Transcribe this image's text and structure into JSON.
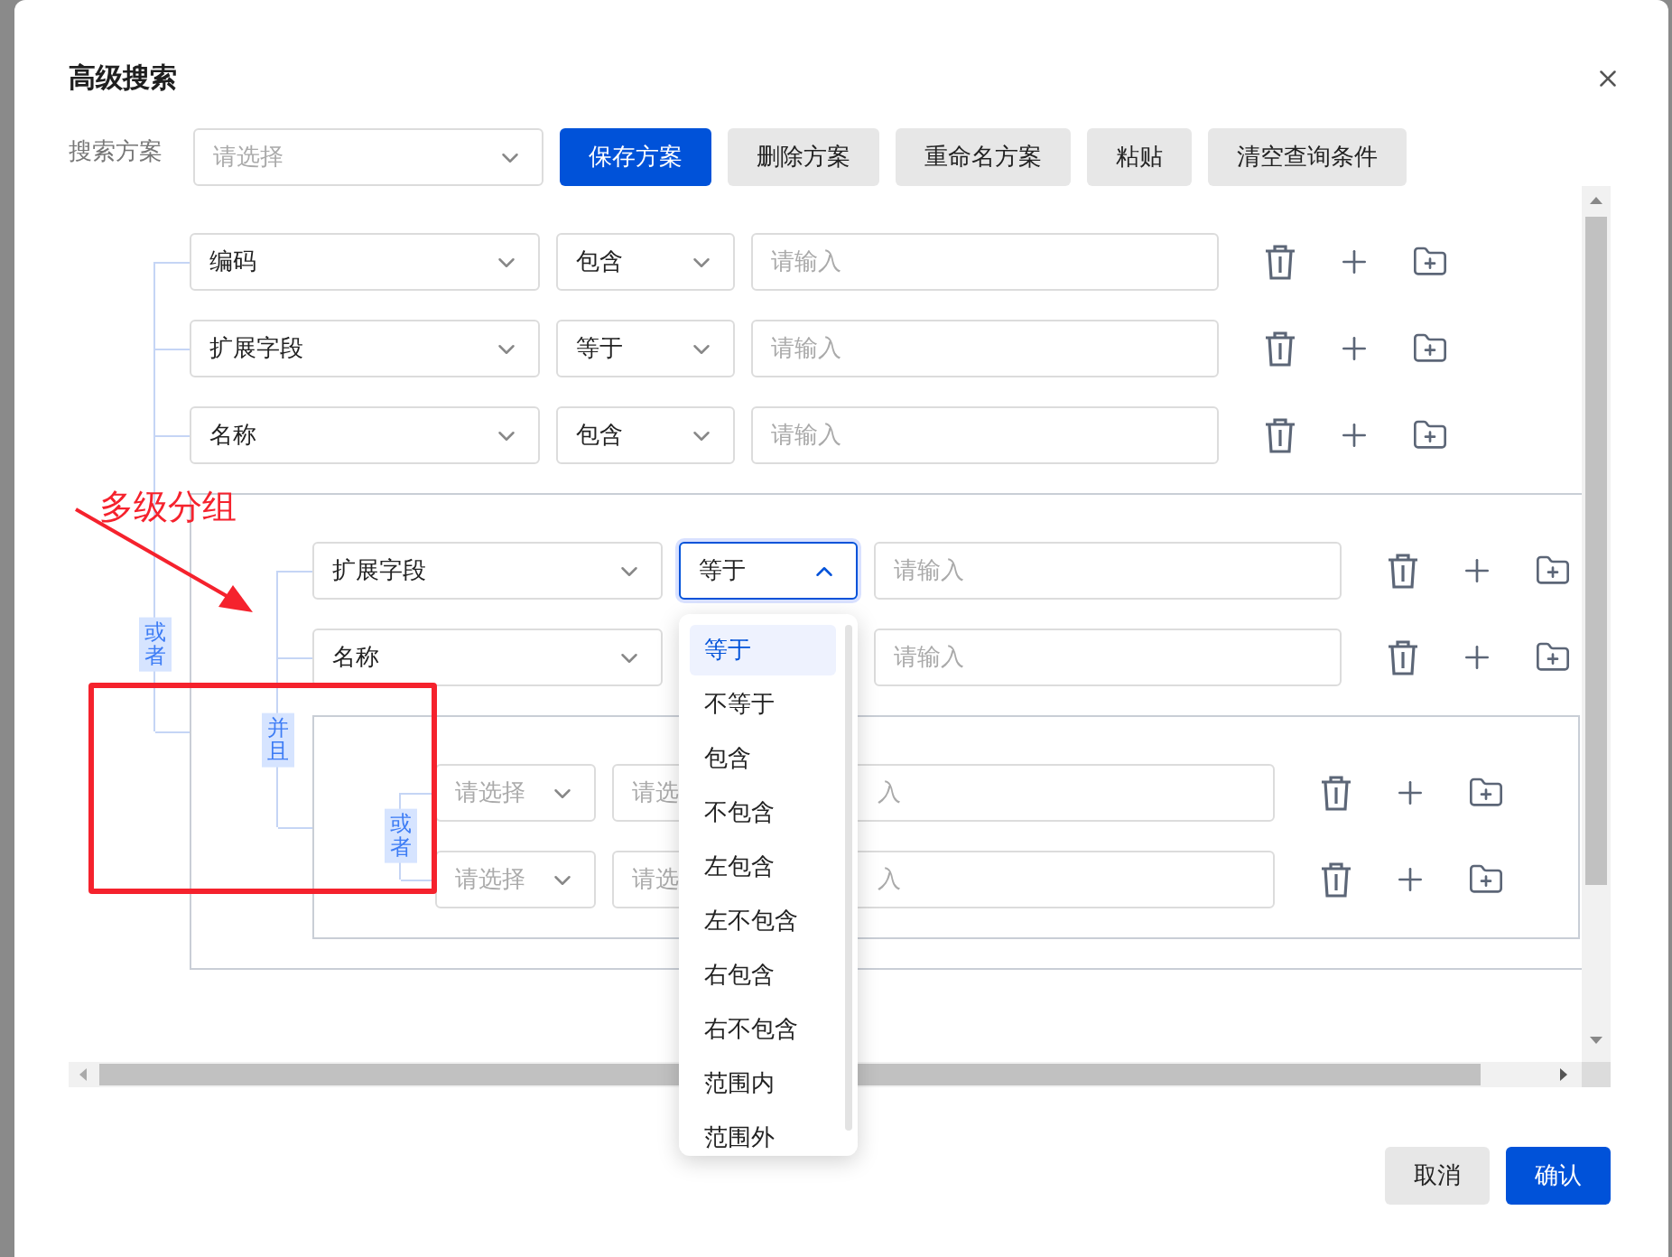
{
  "dialog": {
    "title": "高级搜索"
  },
  "toolbar": {
    "label": "搜索方案",
    "scheme_select": {
      "placeholder": "请选择"
    },
    "buttons": [
      {
        "label": "保存方案",
        "kind": "primary"
      },
      {
        "label": "删除方案",
        "kind": "secondary"
      },
      {
        "label": "重命名方案",
        "kind": "secondary"
      },
      {
        "label": "粘贴",
        "kind": "secondary"
      },
      {
        "label": "清空查询条件",
        "kind": "secondary"
      }
    ]
  },
  "condition_tree": {
    "logic": "或者",
    "children": [
      {
        "kind": "row",
        "field": "编码",
        "operator": "包含",
        "open": false,
        "value_placeholder": "请输入"
      },
      {
        "kind": "row",
        "field": "扩展字段",
        "operator": "等于",
        "open": false,
        "value_placeholder": "请输入"
      },
      {
        "kind": "row",
        "field": "名称",
        "operator": "包含",
        "open": false,
        "value_placeholder": "请输入"
      },
      {
        "kind": "group",
        "logic": "并且",
        "children": [
          {
            "kind": "row",
            "field": "扩展字段",
            "operator": "等于",
            "open": true,
            "value_placeholder": "请输入"
          },
          {
            "kind": "row",
            "field": "名称",
            "value_placeholder": "请输入"
          },
          {
            "kind": "group",
            "logic": "或者",
            "children": [
              {
                "kind": "row",
                "field_placeholder": "请选择",
                "operator_placeholder": "请选",
                "open": false,
                "value_placeholder": "入"
              },
              {
                "kind": "row",
                "field_placeholder": "请选择",
                "operator_placeholder": "请选",
                "open": false,
                "value_placeholder": "入"
              }
            ]
          }
        ]
      }
    ]
  },
  "operator_menu": {
    "options": [
      {
        "label": "等于",
        "selected": true
      },
      {
        "label": "不等于",
        "selected": false
      },
      {
        "label": "包含",
        "selected": false
      },
      {
        "label": "不包含",
        "selected": false
      },
      {
        "label": "左包含",
        "selected": false
      },
      {
        "label": "左不包含",
        "selected": false
      },
      {
        "label": "右包含",
        "selected": false
      },
      {
        "label": "右不包含",
        "selected": false
      },
      {
        "label": "范围内",
        "selected": false
      },
      {
        "label": "范围外",
        "selected": false
      }
    ]
  },
  "footer": {
    "buttons": [
      {
        "label": "取消",
        "kind": "secondary"
      },
      {
        "label": "确认",
        "kind": "primary"
      }
    ]
  },
  "annotation": {
    "label": "多级分组"
  }
}
